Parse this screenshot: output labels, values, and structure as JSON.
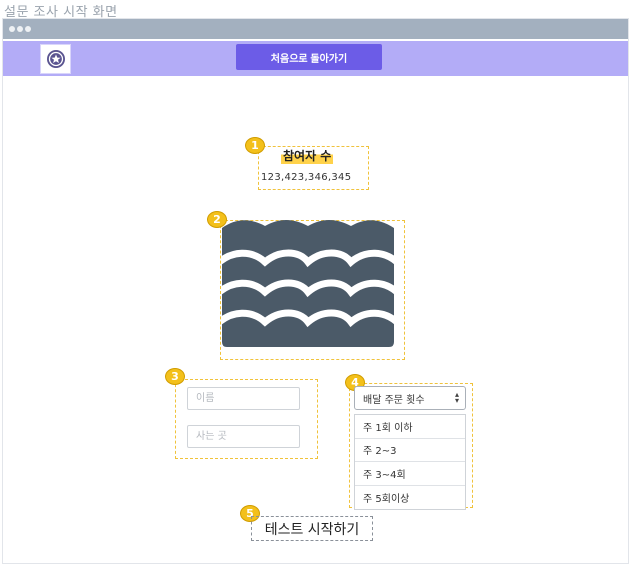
{
  "page_caption": "설문 조사 시작 화면",
  "nav": {
    "logo_icon": "star-badge-icon",
    "back_label": "처음으로 돌아가기"
  },
  "badges": [
    "1",
    "2",
    "3",
    "4",
    "5"
  ],
  "participants": {
    "title": "참여자 수",
    "count": "123,423,346,345"
  },
  "hero": {
    "icon": "waves-icon"
  },
  "form": {
    "name_placeholder": "이름",
    "address_placeholder": "사는 곳"
  },
  "delivery": {
    "selected": "배달 주문 횟수",
    "options": [
      "주 1회 이하",
      "주 2~3",
      "주 3~4회",
      "주 5회이상"
    ]
  },
  "start_label": "테스트 시작하기",
  "colors": {
    "accent": "#6c5ce7",
    "nav_bg": "#b3acf7",
    "badge": "#f3c01b",
    "hero": "#4b5a68"
  }
}
